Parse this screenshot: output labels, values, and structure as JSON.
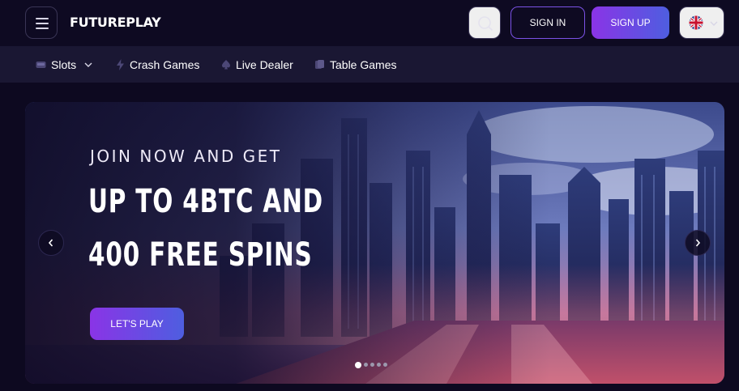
{
  "header": {
    "logo_text": "FUTUREPLAY",
    "sign_in_label": "SIGN IN",
    "sign_up_label": "SIGN UP",
    "language": "English (UK)"
  },
  "nav": {
    "items": [
      {
        "label": "Slots",
        "icon": "slot-machine-icon",
        "has_dropdown": true
      },
      {
        "label": "Crash Games",
        "icon": "lightning-icon",
        "has_dropdown": false
      },
      {
        "label": "Live Dealer",
        "icon": "spade-icon",
        "has_dropdown": false
      },
      {
        "label": "Table Games",
        "icon": "cards-icon",
        "has_dropdown": false
      }
    ]
  },
  "hero": {
    "subtitle": "JOIN NOW AND GET",
    "title_line1": "UP TO 4BTC AND",
    "title_line2": "400 FREE SPINS",
    "cta_label": "LET'S PLAY",
    "slide_count": 5,
    "active_slide": 1
  },
  "colors": {
    "background": "#0d0920",
    "nav_background": "#1a1733",
    "accent_gradient_start": "#8a34e6",
    "accent_gradient_end": "#4e5ee0",
    "outline_accent": "#7b52e6"
  }
}
